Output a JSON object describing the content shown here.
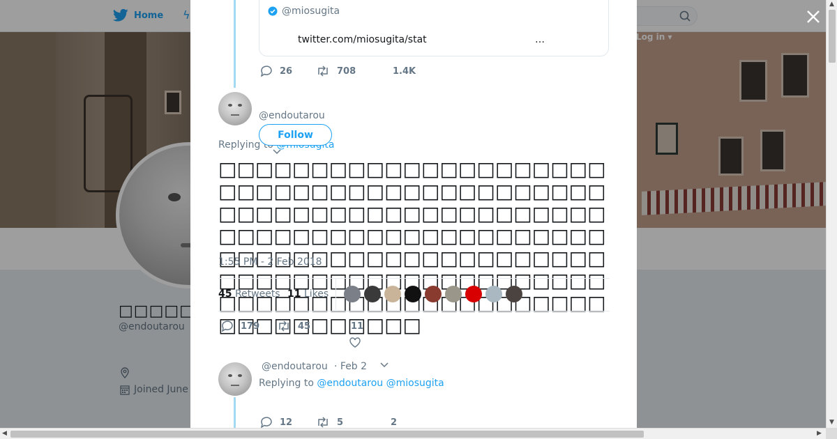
{
  "nav": {
    "home_label": "Home",
    "login_label": "Log in"
  },
  "profile": {
    "display_name": "□□□□□",
    "handle": "@endoutarou",
    "joined": "Joined June"
  },
  "quoted": {
    "handle": "@miosugita",
    "link_text": "twitter.com/miosugita/stat",
    "ellipsis": "…",
    "replies": "26",
    "retweets": "708",
    "likes": "1.4K"
  },
  "main_tweet": {
    "handle": "@endoutarou",
    "follow_label": "Follow",
    "replying_prefix": "Replying to",
    "replying_to": "@miosugita",
    "text": "□□□□□□□□□□□□□□□□□□□□□□□□□□□□□□□□□□□□□□□□□□□□□□□□□□□□□□□□□□□□□□□□□□□□□□□□□□□□□□□□□□□□□□□□□□□□□□□□□□□□□□□□□□□□□□□□□□□□□□□□□□□□□□□□□□□□□□□□□□□□□□□□□□□□□□□□□□□□□□",
    "timestamp": "1:55 PM - 2 Feb 2018",
    "retweets_count": "45",
    "retweets_label": "Retweets",
    "likes_count": "11",
    "likes_label": "Likes",
    "replies": "179",
    "retweet_action": "45",
    "like_action": "11"
  },
  "likers": [
    {
      "name": "liker-1",
      "color": "#7a7f88"
    },
    {
      "name": "liker-2",
      "color": "#3a3a3a"
    },
    {
      "name": "liker-3",
      "color": "#c9b49a"
    },
    {
      "name": "liker-4",
      "color": "#111111"
    },
    {
      "name": "liker-5",
      "color": "#8a3b2f"
    },
    {
      "name": "liker-6",
      "color": "#9a968a"
    },
    {
      "name": "liker-7",
      "color": "#d80000"
    },
    {
      "name": "liker-8",
      "color": "#aab8c2"
    },
    {
      "name": "liker-9",
      "color": "#4a4340"
    }
  ],
  "next_tweet": {
    "handle": "@endoutarou",
    "date": "· Feb 2",
    "replying_prefix": "Replying to",
    "replying_to_1": "@endoutarou",
    "replying_to_2": "@miosugita",
    "replies": "12",
    "retweets": "5",
    "likes": "2"
  },
  "colors": {
    "accent": "#1da1f2",
    "thread": "#a4d9f4",
    "muted": "#657786",
    "text": "#14171a"
  }
}
